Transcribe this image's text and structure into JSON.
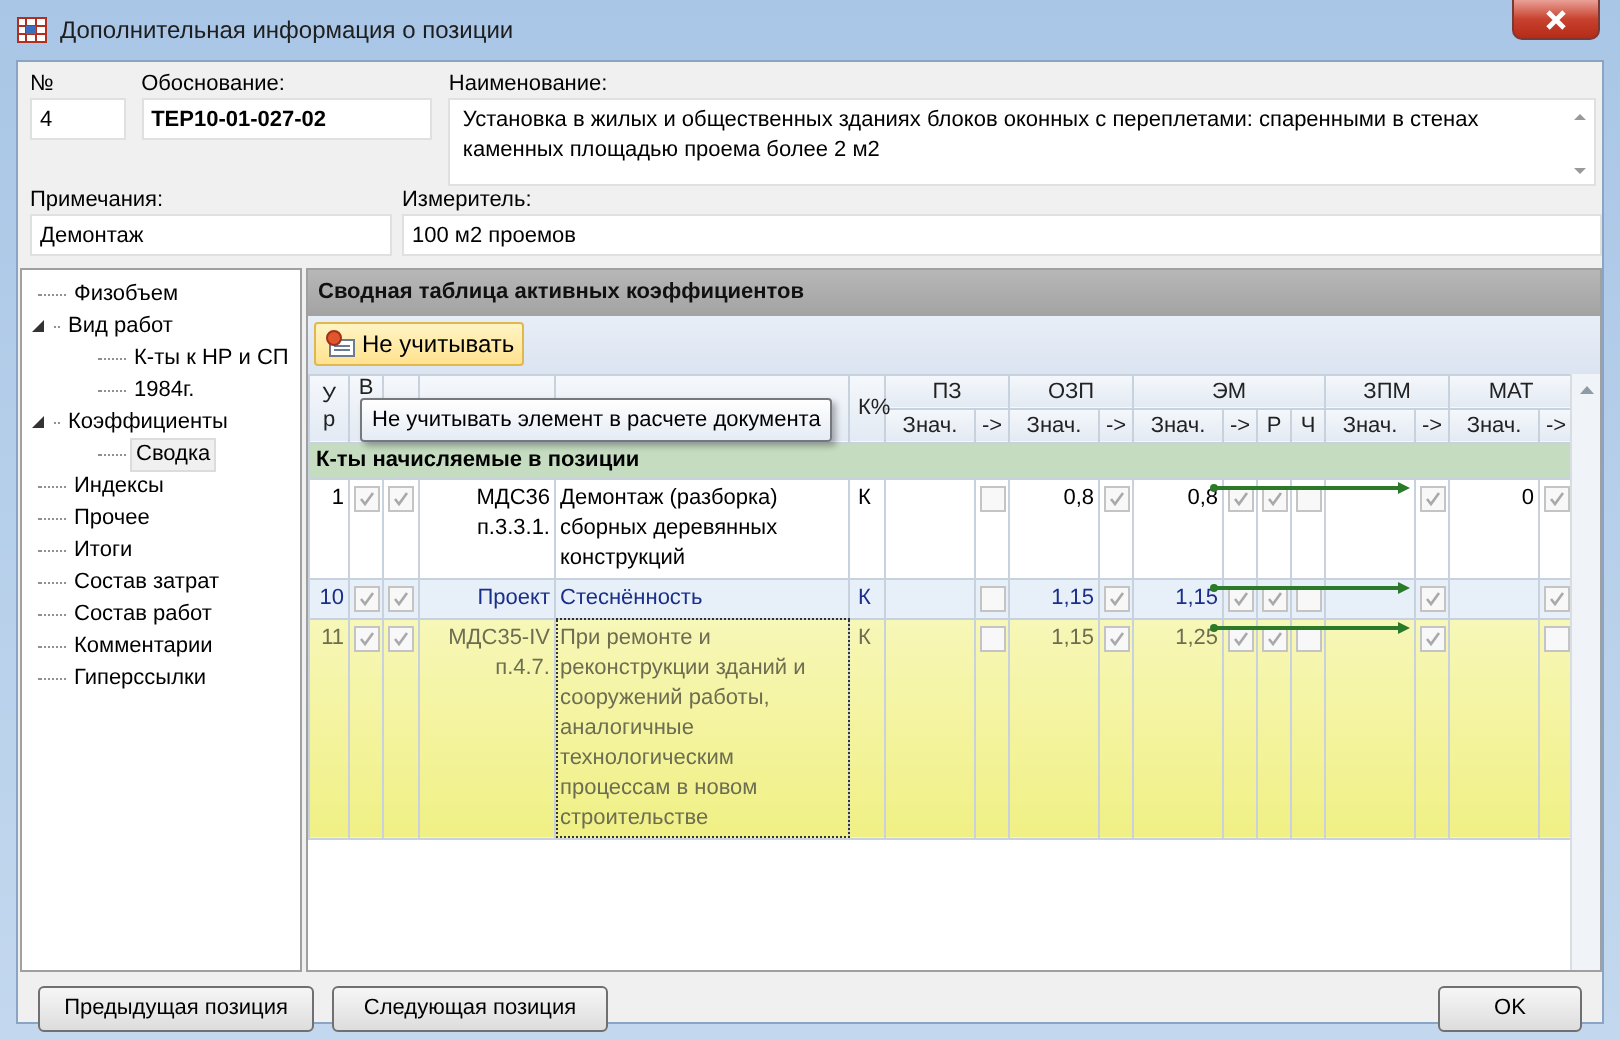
{
  "window": {
    "title": "Дополнительная информация о позиции"
  },
  "fields": {
    "number": {
      "label": "№",
      "value": "4"
    },
    "basis": {
      "label": "Обоснование:",
      "value": "ТЕР10-01-027-02"
    },
    "name": {
      "label": "Наименование:",
      "value": "Установка в жилых и общественных зданиях блоков оконных с переплетами: спаренными в стенах каменных площадью проема более 2 м2"
    },
    "note": {
      "label": "Примечания:",
      "value": "Демонтаж"
    },
    "unit": {
      "label": "Измеритель:",
      "value": "100 м2 проемов"
    }
  },
  "tree": [
    {
      "label": "Физобъем",
      "selected": false
    },
    {
      "label": "Вид работ",
      "expanded": true,
      "selected": false,
      "children": [
        {
          "label": "К-ты к НР и СП",
          "selected": false
        },
        {
          "label": "1984г.",
          "selected": false
        }
      ]
    },
    {
      "label": "Коэффициенты",
      "expanded": true,
      "selected": false,
      "children": [
        {
          "label": "Сводка",
          "selected": true
        }
      ]
    },
    {
      "label": "Индексы",
      "selected": false
    },
    {
      "label": "Прочее",
      "selected": false
    },
    {
      "label": "Итоги",
      "selected": false
    },
    {
      "label": "Состав затрат",
      "selected": false
    },
    {
      "label": "Состав работ",
      "selected": false
    },
    {
      "label": "Комментарии",
      "selected": false
    },
    {
      "label": "Гиперссылки",
      "selected": false
    }
  ],
  "panel": {
    "title": "Сводная таблица активных коэффициентов",
    "toolbar_button": {
      "label": "Не учитывать",
      "hovered": true
    },
    "tooltip": "Не учитывать элемент в расчете документа",
    "grid": {
      "row_header": "Ур",
      "vc_header": "В",
      "k_header": "К%",
      "groups": [
        {
          "label": "ПЗ",
          "subcolumns": [
            "Знач.",
            "->"
          ]
        },
        {
          "label": "ОЗП",
          "subcolumns": [
            "Знач.",
            "->"
          ]
        },
        {
          "label": "ЭМ",
          "subcolumns": [
            "Знач.",
            "->",
            "Р",
            "Ч"
          ]
        },
        {
          "label": "ЗПМ",
          "subcolumns": [
            "Знач.",
            "->"
          ]
        },
        {
          "label": "МАТ",
          "subcolumns": [
            "Знач.",
            "->"
          ]
        }
      ],
      "group_row": "К-ты начисляемые в позиции",
      "rows": [
        {
          "num": "1",
          "kind": "normal",
          "selected": false,
          "checks": [
            true,
            true
          ],
          "basis": "МДС36 п.3.3.1.",
          "name": "Демонтаж (разборка) сборных деревянных конструкций",
          "k": "К",
          "arrow": true,
          "cells": [
            {
              "kind": "value"
            },
            {
              "kind": "check",
              "checked": false
            },
            {
              "kind": "value",
              "value": "0,8"
            },
            {
              "kind": "check",
              "checked": true
            },
            {
              "kind": "value",
              "value": "0,8"
            },
            {
              "kind": "check",
              "checked": true
            },
            {
              "kind": "check",
              "checked": true
            },
            {
              "kind": "check",
              "checked": false
            },
            {
              "kind": "value"
            },
            {
              "kind": "check",
              "checked": true
            },
            {
              "kind": "value",
              "value": "0"
            },
            {
              "kind": "check",
              "checked": true
            }
          ]
        },
        {
          "num": "10",
          "kind": "project",
          "selected": false,
          "checks": [
            true,
            true
          ],
          "basis": "Проект",
          "name": "Стеснённость",
          "k": "К",
          "arrow": true,
          "cells": [
            {
              "kind": "value"
            },
            {
              "kind": "check",
              "checked": false
            },
            {
              "kind": "value",
              "value": "1,15"
            },
            {
              "kind": "check",
              "checked": true
            },
            {
              "kind": "value",
              "value": "1,15"
            },
            {
              "kind": "check",
              "checked": true
            },
            {
              "kind": "check",
              "checked": true
            },
            {
              "kind": "check",
              "checked": false
            },
            {
              "kind": "value"
            },
            {
              "kind": "check",
              "checked": true
            },
            {
              "kind": "value"
            },
            {
              "kind": "check",
              "checked": true
            }
          ]
        },
        {
          "num": "11",
          "kind": "normal",
          "selected": true,
          "checks": [
            true,
            true
          ],
          "basis": "МДС35-IV п.4.7.",
          "name": "При ремонте и реконструкции зданий и сооружений работы, аналогичные технологическим процессам в новом строительстве",
          "k": "К",
          "arrow": true,
          "cells": [
            {
              "kind": "value"
            },
            {
              "kind": "check",
              "checked": false
            },
            {
              "kind": "value",
              "value": "1,15"
            },
            {
              "kind": "check",
              "checked": true
            },
            {
              "kind": "value",
              "value": "1,25"
            },
            {
              "kind": "check",
              "checked": true
            },
            {
              "kind": "check",
              "checked": true
            },
            {
              "kind": "check",
              "checked": false
            },
            {
              "kind": "value"
            },
            {
              "kind": "check",
              "checked": true
            },
            {
              "kind": "value"
            },
            {
              "kind": "check",
              "checked": false
            }
          ]
        }
      ]
    }
  },
  "footer": {
    "left": [
      "Предыдущая позиция",
      "Следующая позиция"
    ],
    "right": [
      "OK"
    ]
  }
}
